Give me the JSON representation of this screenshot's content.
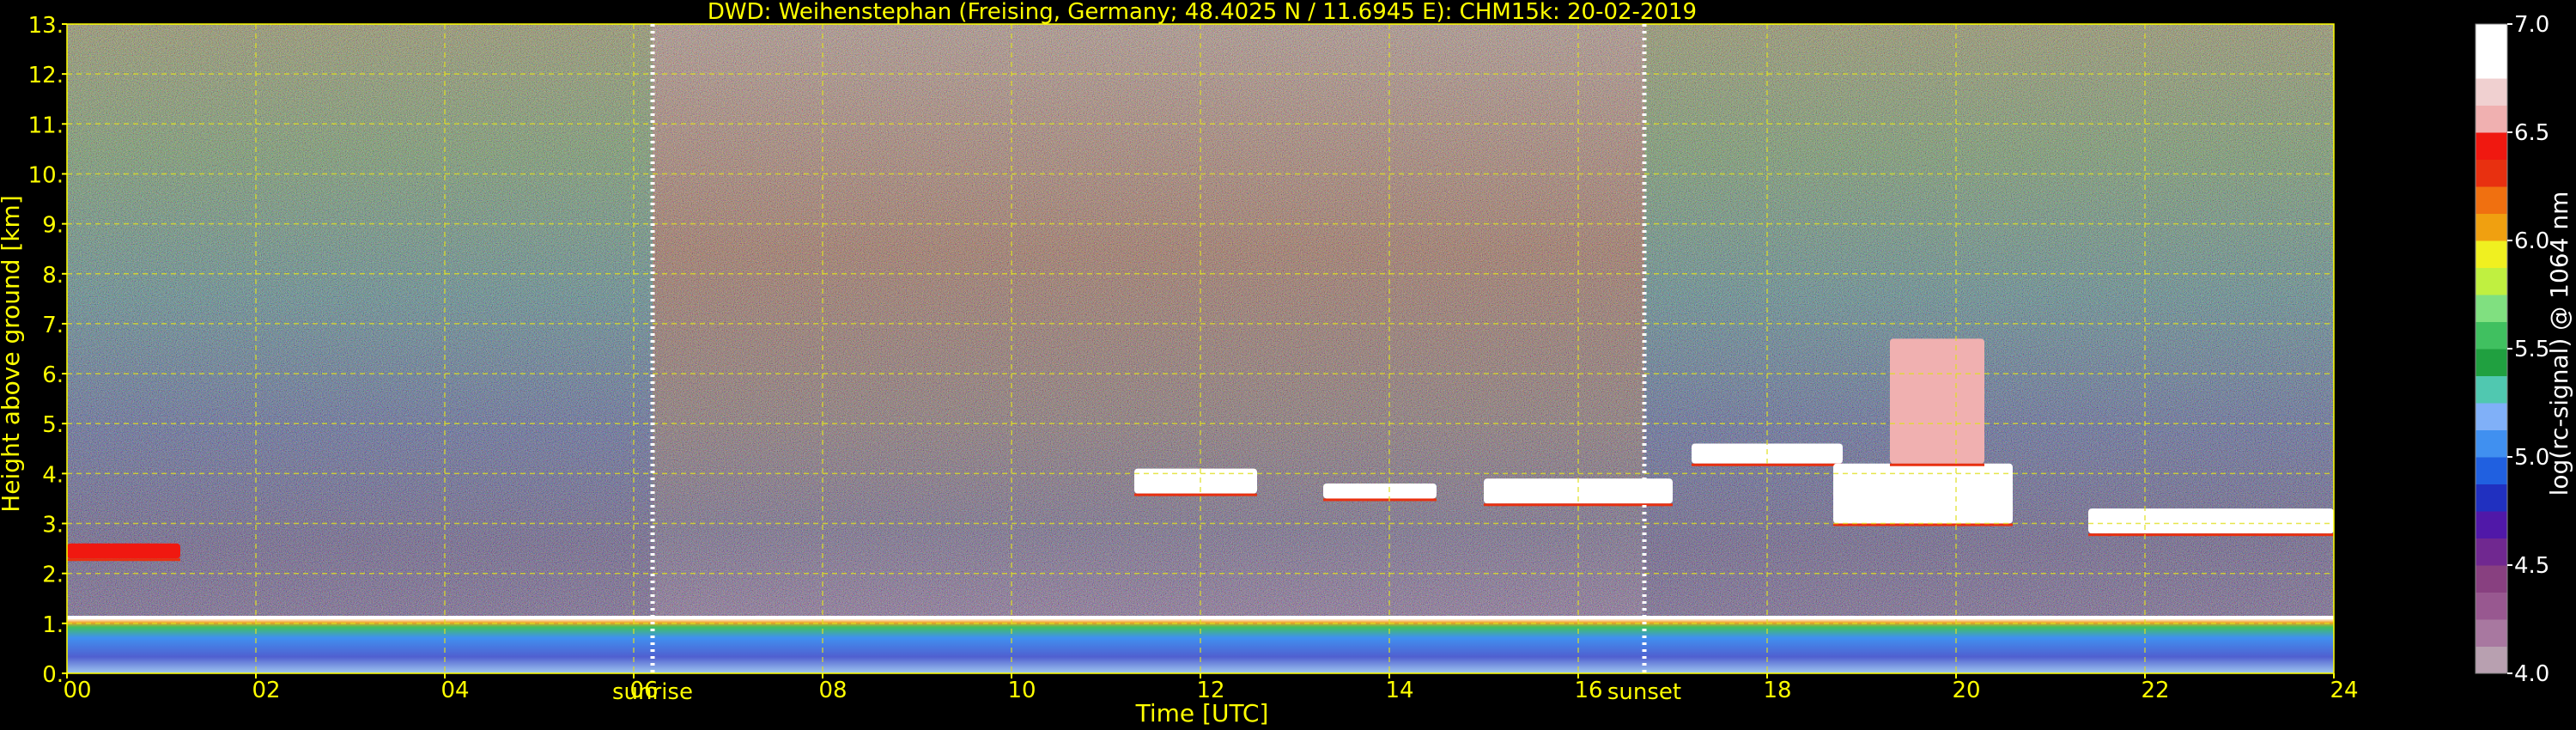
{
  "chart_data": {
    "type": "heatmap",
    "title": "DWD: Weihenstephan (Freising, Germany; 48.4025 N / 11.6945 E):    CHM15k: 20-02-2019",
    "xlabel": "Time [UTC]",
    "ylabel": "Height above ground [km]",
    "xlim": [
      0,
      24
    ],
    "ylim": [
      0,
      13
    ],
    "x_ticks": [
      "00",
      "02",
      "04",
      "06",
      "08",
      "10",
      "12",
      "14",
      "16",
      "18",
      "20",
      "22",
      "24"
    ],
    "y_ticks": [
      "0.",
      "1.",
      "2.",
      "3.",
      "4.",
      "5.",
      "6.",
      "7.",
      "8.",
      "9.",
      "10.",
      "11.",
      "12.",
      "13."
    ],
    "grid": true,
    "events": [
      {
        "label": "sunrise",
        "time": 6.2
      },
      {
        "label": "sunset",
        "time": 16.7
      }
    ],
    "colorbar": {
      "label": "log(rc-signal) @ 1064 nm",
      "range": [
        4.0,
        7.0
      ],
      "ticks": [
        "4.0",
        "4.5",
        "5.0",
        "5.5",
        "6.0",
        "6.5",
        "7.0"
      ],
      "colors": [
        "#b8a0b0",
        "#a878a0",
        "#985890",
        "#884080",
        "#702890",
        "#5018a8",
        "#2030c0",
        "#2060e0",
        "#4090f0",
        "#80b0f8",
        "#50c8b0",
        "#20a040",
        "#40c060",
        "#80e080",
        "#c0f040",
        "#f0f020",
        "#f0a010",
        "#f07010",
        "#e83010",
        "#f01810",
        "#f0b0b0",
        "#f0d0d0",
        "#ffffff",
        "#ffffff"
      ]
    },
    "features": [
      {
        "name": "boundary layer",
        "t0": 0,
        "t1": 24,
        "h0": 0.0,
        "h1": 1.1,
        "level": 5.2
      },
      {
        "name": "residual aerosol layer",
        "t0": 0,
        "t1": 1.2,
        "h0": 2.3,
        "h1": 2.6,
        "level": 6.5
      },
      {
        "name": "cloud",
        "t0": 11.3,
        "t1": 12.6,
        "h0": 3.6,
        "h1": 4.1,
        "level": 7.0
      },
      {
        "name": "cloud",
        "t0": 13.3,
        "t1": 14.5,
        "h0": 3.5,
        "h1": 3.8,
        "level": 7.0
      },
      {
        "name": "cloud",
        "t0": 15.0,
        "t1": 17.0,
        "h0": 3.4,
        "h1": 3.9,
        "level": 7.0
      },
      {
        "name": "cloud",
        "t0": 17.2,
        "t1": 18.8,
        "h0": 4.2,
        "h1": 4.6,
        "level": 7.0
      },
      {
        "name": "cloud",
        "t0": 18.7,
        "t1": 20.6,
        "h0": 3.0,
        "h1": 4.2,
        "level": 7.0
      },
      {
        "name": "cloud",
        "t0": 19.3,
        "t1": 20.3,
        "h0": 4.2,
        "h1": 6.7,
        "level": 6.6
      },
      {
        "name": "cloud",
        "t0": 21.4,
        "t1": 24.0,
        "h0": 2.8,
        "h1": 3.3,
        "level": 7.0
      }
    ]
  }
}
